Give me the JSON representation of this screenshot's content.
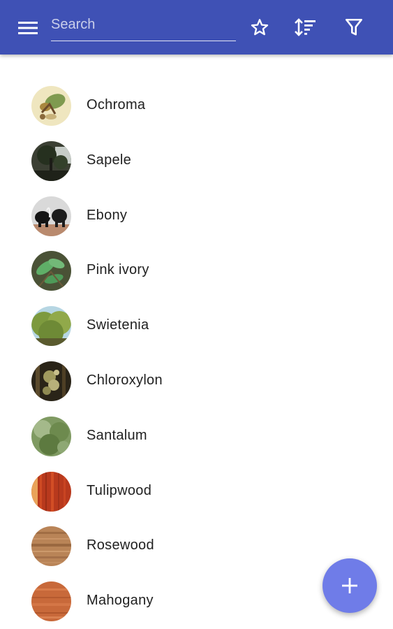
{
  "colors": {
    "toolbar": "#3f51b5",
    "fab": "#6f7ce8",
    "text": "#212121"
  },
  "toolbar": {
    "menu_icon": "menu-icon",
    "search_placeholder": "Search",
    "search_value": "",
    "favorites_icon": "star-outline-icon",
    "sort_icon": "sort-icon",
    "filter_icon": "filter-icon"
  },
  "items": [
    {
      "label": "Ochroma"
    },
    {
      "label": "Sapele"
    },
    {
      "label": "Ebony"
    },
    {
      "label": "Pink ivory"
    },
    {
      "label": "Swietenia"
    },
    {
      "label": "Chloroxylon"
    },
    {
      "label": "Santalum"
    },
    {
      "label": "Tulipwood"
    },
    {
      "label": "Rosewood"
    },
    {
      "label": "Mahogany"
    }
  ],
  "fab": {
    "icon": "plus-icon"
  }
}
